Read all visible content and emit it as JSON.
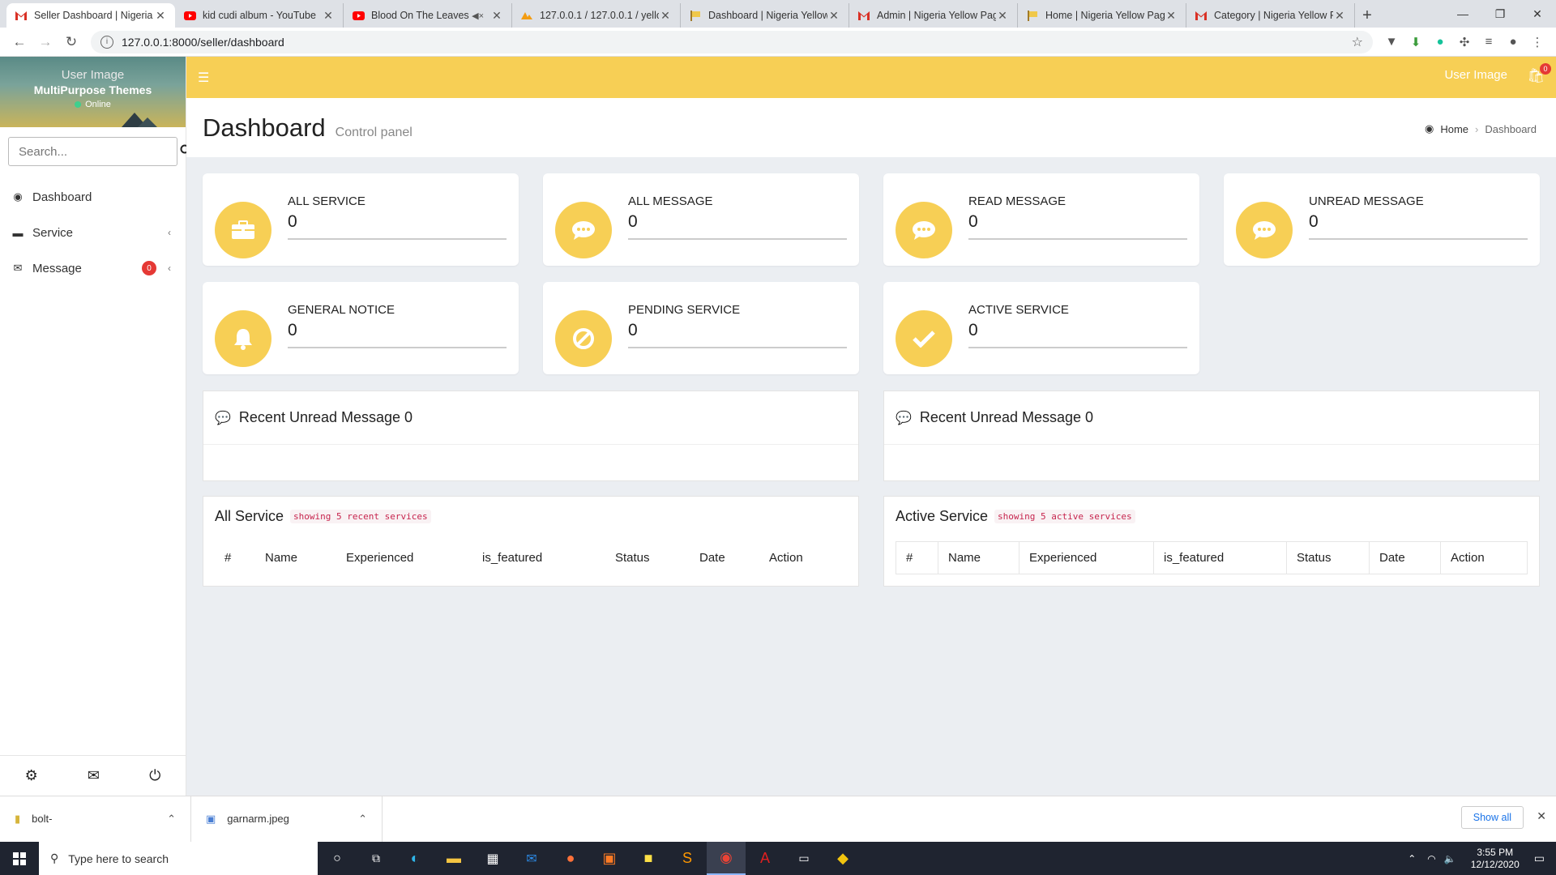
{
  "browser": {
    "tabs": [
      {
        "title": "Seller Dashboard | Nigeria Y",
        "icon": "gmail-icon",
        "active": true
      },
      {
        "title": "kid cudi album - YouTube",
        "icon": "youtube-icon"
      },
      {
        "title": "Blood On The Leaves - ",
        "icon": "youtube-icon",
        "muted": true
      },
      {
        "title": "127.0.0.1 / 127.0.0.1 / yello",
        "icon": "phpmyadmin-icon"
      },
      {
        "title": "Dashboard | Nigeria Yellow",
        "icon": "flag-icon"
      },
      {
        "title": "Admin | Nigeria Yellow Page",
        "icon": "gmail-icon"
      },
      {
        "title": "Home | Nigeria Yellow Page",
        "icon": "flag-icon"
      },
      {
        "title": "Category | Nigeria Yellow Pa",
        "icon": "gmail-icon"
      }
    ],
    "url": "127.0.0.1:8000/seller/dashboard"
  },
  "sidebar": {
    "user_image_alt": "User Image",
    "user_name": "MultiPurpose Themes",
    "status": "Online",
    "search_placeholder": "Search...",
    "items": [
      {
        "label": "Dashboard",
        "icon": "dashboard-icon"
      },
      {
        "label": "Service",
        "icon": "briefcase-icon"
      },
      {
        "label": "Message",
        "icon": "envelope-icon",
        "badge": "0"
      }
    ]
  },
  "topbar": {
    "user_image_alt": "User Image",
    "notification_count": "0"
  },
  "page": {
    "title": "Dashboard",
    "subtitle": "Control panel",
    "breadcrumb_home": "Home",
    "breadcrumb_current": "Dashboard"
  },
  "cards": [
    {
      "title": "ALL SERVICE",
      "value": "0",
      "icon": "briefcase-icon"
    },
    {
      "title": "ALL MESSAGE",
      "value": "0",
      "icon": "chat-icon"
    },
    {
      "title": "READ MESSAGE",
      "value": "0",
      "icon": "chat-icon"
    },
    {
      "title": "UNREAD MESSAGE",
      "value": "0",
      "icon": "chat-icon"
    },
    {
      "title": "GENERAL NOTICE",
      "value": "0",
      "icon": "bell-icon"
    },
    {
      "title": "PENDING SERVICE",
      "value": "0",
      "icon": "ban-icon"
    },
    {
      "title": "ACTIVE SERVICE",
      "value": "0",
      "icon": "check-icon"
    }
  ],
  "recent_panels": [
    {
      "title": "Recent Unread Message 0"
    },
    {
      "title": "Recent Unread Message 0"
    }
  ],
  "all_service": {
    "title": "All Service",
    "note": "showing 5 recent services",
    "columns": [
      "#",
      "Name",
      "Experienced",
      "is_featured",
      "Status",
      "Date",
      "Action"
    ]
  },
  "active_service": {
    "title": "Active Service",
    "note": "showing 5 active services",
    "columns": [
      "#",
      "Name",
      "Experienced",
      "is_featured",
      "Status",
      "Date",
      "Action"
    ]
  },
  "downloads": [
    {
      "name": "bolt-"
    },
    {
      "name": "garnarm.jpeg"
    }
  ],
  "downloads_show_all": "Show all",
  "taskbar": {
    "search_placeholder": "Type here to search",
    "time": "3:55 PM",
    "date": "12/12/2020"
  },
  "colors": {
    "accent": "#f7cf55",
    "background": "#ebeef2"
  }
}
